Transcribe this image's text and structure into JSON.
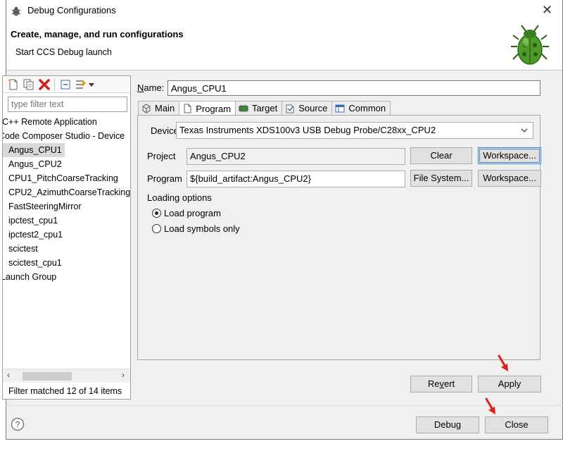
{
  "window": {
    "title": "Debug Configurations"
  },
  "header": {
    "title": "Create, manage, and run configurations",
    "subtitle": "Start CCS Debug launch",
    "logo_icon": "green-bug-icon"
  },
  "left_panel": {
    "toolbar_icons": [
      "new-config-icon",
      "duplicate-icon",
      "delete-icon",
      "collapse-all-icon",
      "filter-icon",
      "dropdown-icon"
    ],
    "filter_placeholder": "type filter text",
    "items": [
      {
        "label": "C++ Remote Application"
      },
      {
        "label": "Code Composer Studio - Device"
      },
      {
        "label": "Angus_CPU1",
        "selected": true
      },
      {
        "label": "Angus_CPU2"
      },
      {
        "label": "CPU1_PitchCoarseTracking"
      },
      {
        "label": "CPU2_AzimuthCoarseTracking"
      },
      {
        "label": "FastSteeringMirror"
      },
      {
        "label": "ipctest_cpu1"
      },
      {
        "label": "ipctest2_cpu1"
      },
      {
        "label": "scictest"
      },
      {
        "label": "scictest_cpu1"
      },
      {
        "label": "Launch Group"
      }
    ],
    "filter_status": "Filter matched 12 of 14 items"
  },
  "config": {
    "name_label": "Name:",
    "name_value": "Angus_CPU1",
    "tabs": [
      {
        "label": "Main",
        "icon": "main-icon"
      },
      {
        "label": "Program",
        "icon": "program-icon",
        "active": true
      },
      {
        "label": "Target",
        "icon": "target-icon"
      },
      {
        "label": "Source",
        "icon": "source-icon"
      },
      {
        "label": "Common",
        "icon": "common-icon"
      }
    ],
    "device_label": "Device",
    "device_value": "Texas Instruments XDS100v3 USB Debug Probe/C28xx_CPU2",
    "project_label": "Project",
    "project_value": "Angus_CPU2",
    "clear_button": "Clear",
    "workspace_button_1": "Workspace...",
    "program_label": "Program",
    "program_value": "${build_artifact:Angus_CPU2}",
    "filesystem_button": "File System...",
    "workspace_button_2": "Workspace...",
    "loading_options_label": "Loading options",
    "radio_load_program": "Load program",
    "radio_load_symbols": "Load symbols only",
    "selected_loading_option": "Load program"
  },
  "buttons": {
    "revert": "Revert",
    "apply": "Apply",
    "debug": "Debug",
    "close": "Close"
  },
  "colors": {
    "dialog_bg": "#f0f0f0",
    "selection": "#d9d9d9",
    "annotation_arrow": "#e0201a",
    "focus_border": "#3a7bd5"
  }
}
